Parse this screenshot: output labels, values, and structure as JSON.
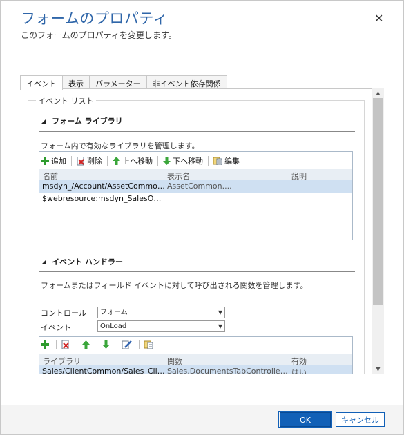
{
  "dialog": {
    "title": "フォームのプロパティ",
    "subtitle": "このフォームのプロパティを変更します。",
    "close_glyph": "✕"
  },
  "tabs": [
    {
      "label": "イベント",
      "active": true
    },
    {
      "label": "表示",
      "active": false
    },
    {
      "label": "パラメーター",
      "active": false
    },
    {
      "label": "非イベント依存関係",
      "active": false
    }
  ],
  "event_list": {
    "legend": "イベント リスト",
    "form_library": {
      "title": "フォーム ライブラリ",
      "description": "フォーム内で有効なライブラリを管理します。",
      "toolbar": {
        "add": "追加",
        "remove": "削除",
        "up": "上へ移動",
        "down": "下へ移動",
        "edit": "編集"
      },
      "columns": [
        "名前",
        "表示名",
        "説明"
      ],
      "rows": [
        {
          "name": "msdyn_/Account/AssetCommon....",
          "display_name": "AssetCommon....",
          "description": "",
          "selected": true
        },
        {
          "name": "$webresource:msdyn_SalesOmni...",
          "display_name": "",
          "description": "",
          "selected": false
        }
      ]
    },
    "event_handlers": {
      "title": "イベント ハンドラー",
      "description": "フォームまたはフィールド イベントに対して呼び出される関数を管理します。",
      "control_label": "コントロール",
      "control_value": "フォーム",
      "event_label": "イベント",
      "event_value": "OnLoad",
      "columns": [
        "ライブラリ",
        "関数",
        "有効"
      ],
      "rows": [
        {
          "library": "Sales/ClientCommon/Sales_Clien...",
          "function": "Sales.DocumentsTabController.s...",
          "enabled": "はい",
          "selected": true
        }
      ]
    }
  },
  "buttons": {
    "ok": "OK",
    "cancel": "キャンセル"
  },
  "colors": {
    "title": "#2f66a9",
    "accent": "#1160b7",
    "selected_row": "#cfe0f2",
    "add_icon": "#2e9b2e",
    "arrow_icon": "#3aa63a"
  }
}
